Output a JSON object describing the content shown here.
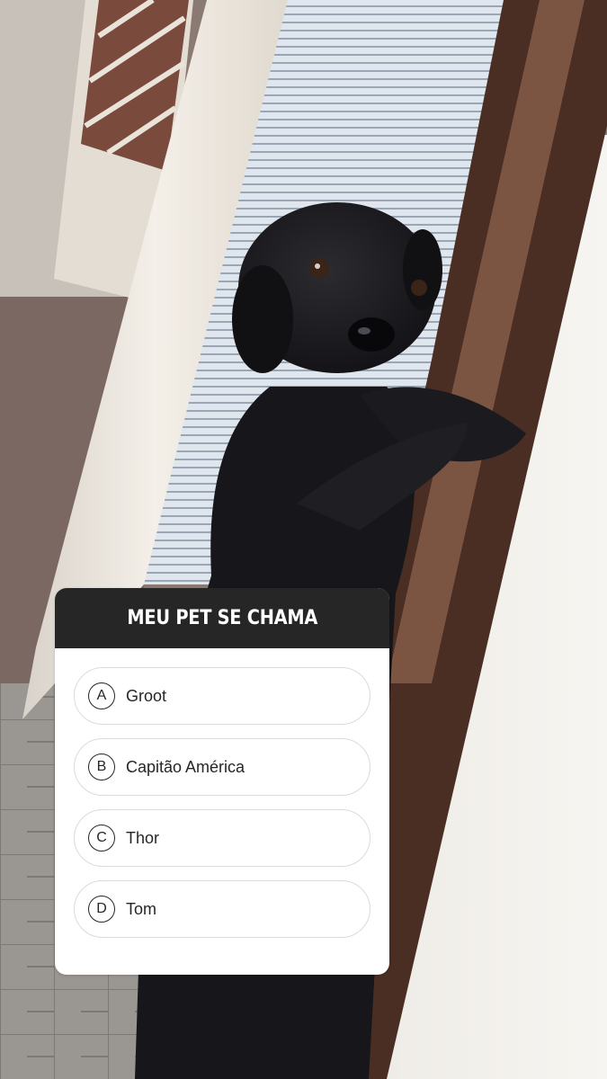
{
  "quiz": {
    "title": "MEU PET SE CHAMA",
    "options": [
      {
        "letter": "A",
        "text": "Groot"
      },
      {
        "letter": "B",
        "text": "Capitão América"
      },
      {
        "letter": "C",
        "text": "Thor"
      },
      {
        "letter": "D",
        "text": "Tom"
      }
    ]
  },
  "colors": {
    "header_bg": "#262626",
    "header_text": "#ffffff",
    "option_border": "#dbdbdb",
    "card_bg": "#ffffff"
  },
  "icons": [
    "circle-letter-icon"
  ]
}
